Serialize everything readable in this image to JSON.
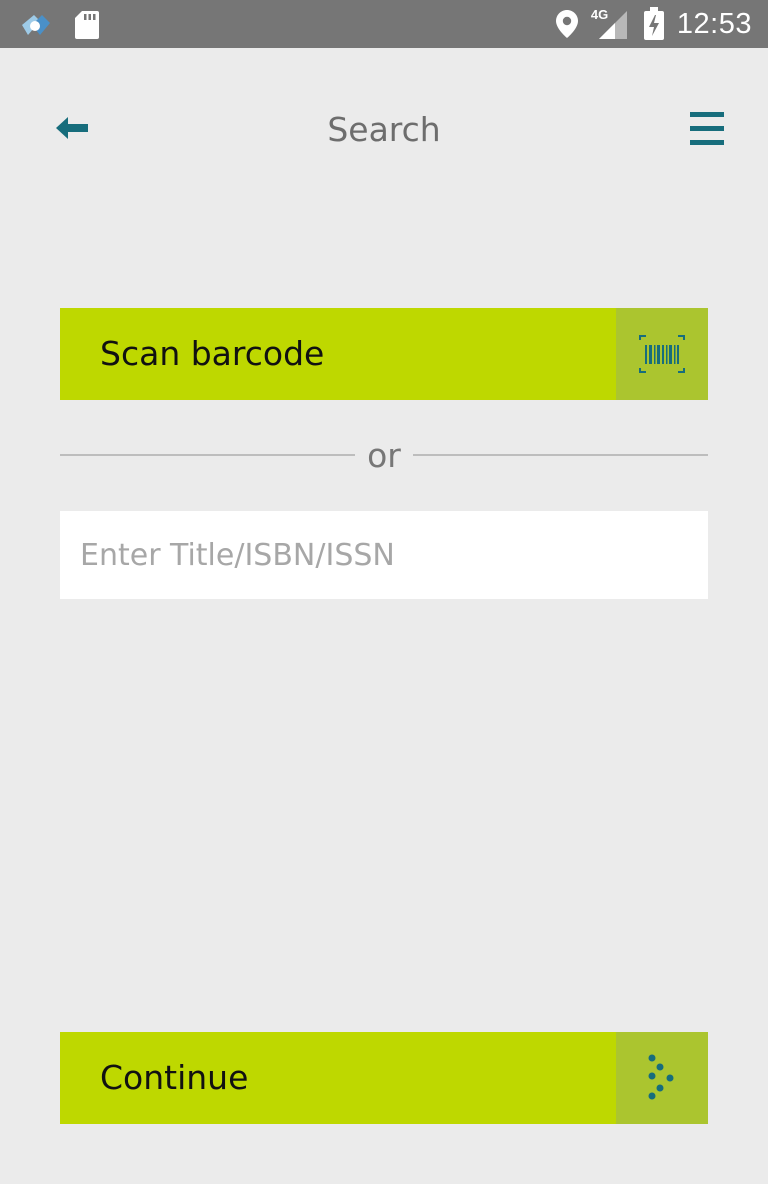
{
  "status_bar": {
    "time": "12:53",
    "network": "4G",
    "icons": [
      "app-notification-icon",
      "sd-card-icon",
      "location-icon",
      "signal-icon",
      "battery-charging-icon"
    ]
  },
  "header": {
    "title": "Search",
    "back_icon": "back-arrow-icon",
    "menu_icon": "hamburger-menu-icon"
  },
  "scan": {
    "label": "Scan barcode",
    "icon": "barcode-icon"
  },
  "divider": {
    "text": "or"
  },
  "search": {
    "value": "",
    "placeholder": "Enter Title/ISBN/ISSN"
  },
  "continue": {
    "label": "Continue",
    "icon": "dotted-arrow-icon"
  },
  "colors": {
    "accent_green": "#bed800",
    "icon_box_green": "#abc52f",
    "teal": "#176d7c",
    "background": "#ebebeb",
    "status_bar": "#767676"
  }
}
